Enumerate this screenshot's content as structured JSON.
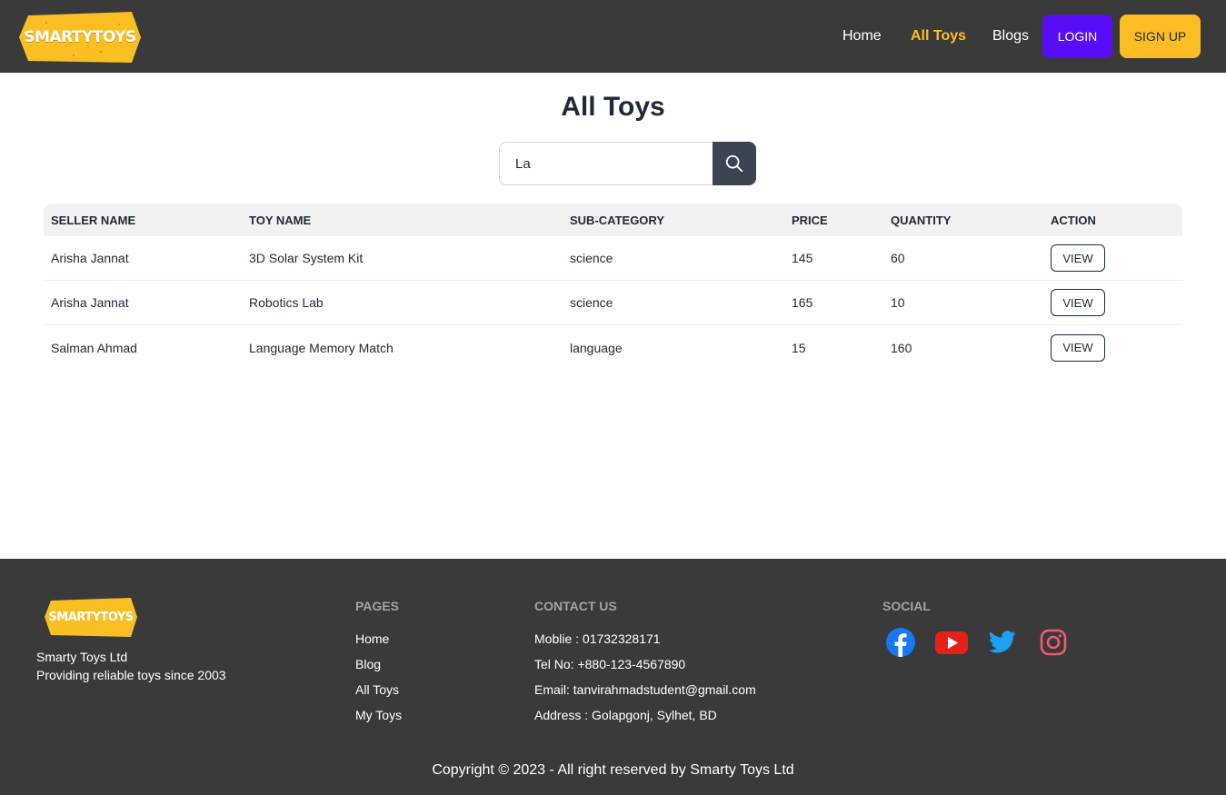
{
  "header": {
    "logo_text": "SMARTYTOYS",
    "nav": {
      "home": "Home",
      "all_toys": "All Toys",
      "blogs": "Blogs"
    },
    "login": "LOGIN",
    "signup": "SIGN UP"
  },
  "main": {
    "title": "All Toys",
    "search": {
      "value": "La",
      "icon": "search-icon"
    },
    "table": {
      "headers": [
        "SELLER NAME",
        "TOY NAME",
        "SUB-CATEGORY",
        "PRICE",
        "QUANTITY",
        "ACTION"
      ],
      "rows": [
        {
          "seller": "Arisha Jannat",
          "toy": "3D Solar System Kit",
          "sub": "science",
          "price": "145",
          "qty": "60",
          "action": "VIEW"
        },
        {
          "seller": "Arisha Jannat",
          "toy": "Robotics Lab",
          "sub": "science",
          "price": "165",
          "qty": "10",
          "action": "VIEW"
        },
        {
          "seller": "Salman Ahmad",
          "toy": "Language Memory Match",
          "sub": "language",
          "price": "15",
          "qty": "160",
          "action": "VIEW"
        }
      ]
    }
  },
  "footer": {
    "logo_text": "SMARTYTOYS",
    "company": "Smarty Toys Ltd",
    "tagline": "Providing reliable toys since 2003",
    "pages_heading": "PAGES",
    "pages": [
      "Home",
      "Blog",
      "All Toys",
      "My Toys"
    ],
    "contact_heading": "CONTACT US",
    "contact": [
      "Moblie : 01732328171",
      "Tel No: +880-123-4567890",
      "Email: tanvirahmadstudent@gmail.com",
      "Address : Golapgonj, Sylhet, BD"
    ],
    "social_heading": "SOCIAL",
    "social_icons": [
      "facebook-icon",
      "youtube-icon",
      "twitter-icon",
      "instagram-icon"
    ],
    "copyright": "Copyright © 2023 - All right reserved by Smarty Toys Ltd"
  },
  "colors": {
    "header_bg": "#3a3a3a",
    "accent_yellow": "#fbbd23",
    "login_purple": "#570df8",
    "search_button": "#3d4451"
  }
}
